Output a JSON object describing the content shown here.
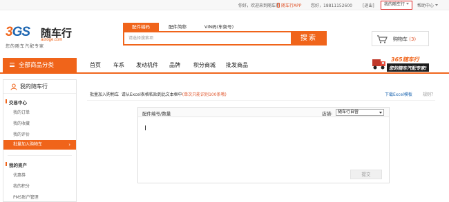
{
  "topbar": {
    "welcome": "你好，欢迎来到随车行",
    "app": "随车行APP",
    "greeting": "您好，18811152600",
    "logout": "[退出]",
    "my_account": "我的随车行",
    "help": "帮助中心"
  },
  "logo": {
    "mark_a": "3",
    "mark_b": "GS",
    "brand": "随车行",
    "domain": "autoge.com",
    "slogan": "您的随车汽配专家"
  },
  "search": {
    "tabs": [
      "配件编码",
      "配件简称",
      "VIN码(车架号)"
    ],
    "active_tab": 0,
    "placeholder": "请选择搜索项",
    "button": "搜索"
  },
  "cart": {
    "label": "购物车",
    "count": "(3)"
  },
  "nav": {
    "all_categories": "全部商品分类",
    "items": [
      "首页",
      "车系",
      "发动机件",
      "品牌",
      "积分商城",
      "批发商品"
    ]
  },
  "banner": {
    "brand": "365随车行",
    "tagline": "您的随车汽配专家!"
  },
  "sidebar": {
    "title": "我的随车行",
    "sections": [
      {
        "label": "交易中心",
        "items": [
          "我的订单",
          "我的收藏",
          "我的评价"
        ]
      },
      {
        "label": "我的资产",
        "items": [
          "优惠券",
          "我的积分",
          "PMS账户管理"
        ]
      }
    ],
    "active_item": "批量加入购物车",
    "active_arrow": "›"
  },
  "main": {
    "crumb": "批量加入购物车",
    "instruction": "请从Excel表格粘贴到此文本框中",
    "hint": "(单次只能识别100条哦)",
    "download": "下载Excel模板",
    "rule": "规则？",
    "col_label": "配件编号/数量",
    "store_label": "店铺:",
    "store_value": "随车行自营",
    "submit": "提交"
  },
  "colors": {
    "accent": "#f0641a",
    "link": "#1f67b1",
    "alert": "#e02020"
  }
}
